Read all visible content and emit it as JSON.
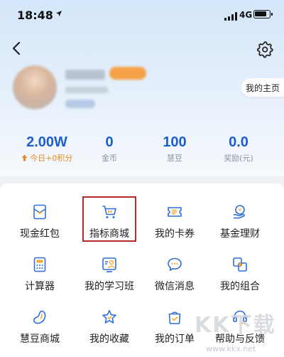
{
  "status_bar": {
    "time": "18:48",
    "network": "4G"
  },
  "header": {
    "back_icon": "chevron-left-icon",
    "settings_icon": "gear-icon"
  },
  "profile": {
    "home_link": "我的主页"
  },
  "stats": [
    {
      "value": "2.00W",
      "label": "今日+0积分",
      "label_icon": "arrow-up-icon"
    },
    {
      "value": "0",
      "label": "金币"
    },
    {
      "value": "100",
      "label": "慧豆"
    },
    {
      "value": "0.0",
      "label": "奖励(元)"
    }
  ],
  "menu": [
    {
      "label": "现金红包",
      "icon": "red-packet-icon"
    },
    {
      "label": "指标商城",
      "icon": "shopping-cart-icon"
    },
    {
      "label": "我的卡券",
      "icon": "ticket-icon"
    },
    {
      "label": "基金理财",
      "icon": "fund-icon"
    },
    {
      "label": "计算器",
      "icon": "calculator-icon"
    },
    {
      "label": "我的学习班",
      "icon": "study-class-icon"
    },
    {
      "label": "微信消息",
      "icon": "chat-bubble-icon"
    },
    {
      "label": "我的组合",
      "icon": "portfolio-icon"
    },
    {
      "label": "慧豆商城",
      "icon": "bean-icon"
    },
    {
      "label": "我的收藏",
      "icon": "star-icon"
    },
    {
      "label": "我的订单",
      "icon": "order-bag-icon"
    },
    {
      "label": "帮助与反馈",
      "icon": "headset-icon"
    }
  ],
  "watermark": {
    "text": "KK下载",
    "url": "www.kkx.net"
  },
  "colors": {
    "accent": "#1d5fc9",
    "highlight": "#b22a2a",
    "points": "#e98a1f"
  }
}
